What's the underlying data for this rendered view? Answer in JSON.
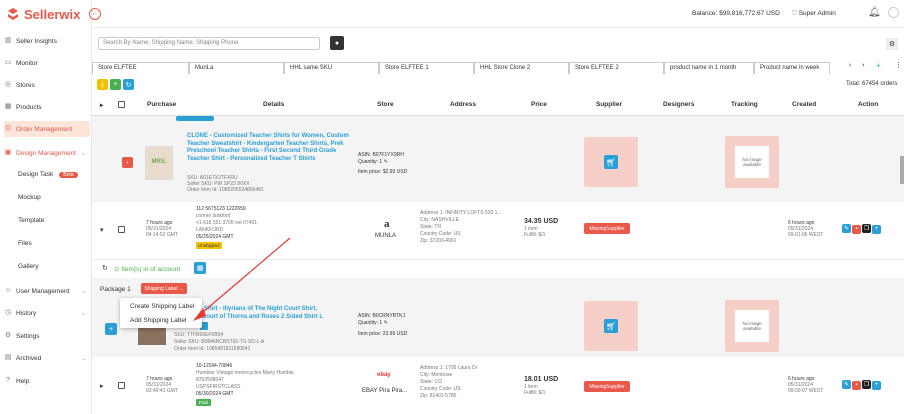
{
  "app": {
    "name": "Sellerwix"
  },
  "colors": {
    "brand": "#e8594a",
    "accent": "#2a9fd6",
    "green": "#4caf50",
    "dark": "#333333",
    "yellow": "#f2c200"
  },
  "header": {
    "balance": "Balance: $99,816,772.67 USD",
    "role": "Super Admin"
  },
  "sidebar": {
    "items": [
      {
        "label": "Seller Insights",
        "icon": "chart-icon"
      },
      {
        "label": "Monitor",
        "icon": "monitor-icon"
      },
      {
        "label": "Stores",
        "icon": "store-icon"
      },
      {
        "label": "Products",
        "icon": "grid-icon"
      },
      {
        "label": "Order Management",
        "icon": "cart-icon"
      },
      {
        "label": "Design Management",
        "icon": "palette-icon"
      },
      {
        "label": "User Management",
        "icon": "users-icon"
      },
      {
        "label": "History",
        "icon": "history-icon"
      },
      {
        "label": "Settings",
        "icon": "gear-icon"
      },
      {
        "label": "Archived",
        "icon": "archive-icon"
      },
      {
        "label": "Help",
        "icon": "help-icon"
      }
    ],
    "sub_items": [
      "Design Task",
      "Mockup",
      "Template",
      "Files",
      "Gallery"
    ],
    "beta": "Beta"
  },
  "search": {
    "placeholder": "Search By Name, Shipping Name, Shipping Phone"
  },
  "tabs": [
    "Store ELFTEE",
    "MunLa",
    "HHL same SKU",
    "Store ELFTEE 1",
    "HHL Store Clone 2",
    "Store ELFTEE 2",
    "product name in 1 month",
    "Product name in week"
  ],
  "total": "Total: 67454 orders",
  "columns": [
    "Purchase",
    "Details",
    "Store",
    "Address",
    "Price",
    "Supplier",
    "Designers",
    "Tracking",
    "Created",
    "Action"
  ],
  "row1": {
    "title": "CLONE - Customized Teacher Shirts for Women, Custom Teacher Sweatshirt - Kindergarten Teacher Shirts, Prek Preschool Teacher Shirts - First Second Third Grade Teacher Shirt - Personalized Teacher T Shirts",
    "sku": "SKU: A01E7X2TFXRU",
    "seller_sku": "Seller SKU: PW SP22 80XX",
    "order_item": "Order Item Id: 1085295534866481",
    "asin": "ASIN: B07F1YX9RH",
    "qty": "Quantity: 1",
    "item_price": "Item price: $2.99 USD",
    "no_image": "No image available",
    "thumb": "MRS."
  },
  "row2": {
    "time": "7 hours ago",
    "date": "05/31/2024",
    "time2": "04:14:52 GMT",
    "info": [
      "112 5675123 1222659",
      "conner lankford",
      "+1 618 551 3705 ext 07401",
      "LANKFORD",
      "05/25/2024 GMT"
    ],
    "status": "Unshipped",
    "store": "MUNLA",
    "addr": [
      "Address 1: INFINITY LOFTS 520 1...",
      "City: NASHVILLE",
      "State: TN",
      "Country Code: US",
      "Zip: 37203-4061"
    ],
    "price": "34.35 USD",
    "qty": "1 item",
    "fulfil": "Fulfill: $/1",
    "supplier": "MissingSupplier",
    "created": "6 hours ago",
    "created_date": "05/31/2024",
    "created_time": "09:01:06 WEST"
  },
  "toolbar2": {
    "label": "Item(s) in of account"
  },
  "package": {
    "label": "Package 1",
    "button": "Shipping Label",
    "menu": [
      "Create Shipping Label",
      "Add Shipping Label"
    ]
  },
  "row3": {
    "title_line1": "Shirt - Illyrians of The Night Court Shirt,",
    "title_line2": "Court of Thorns and Roses 2 Sided Shirt L",
    "sku": "SKU: TTFB66EF6B94",
    "seller_sku": "Seller SKU: B0846RCBST92-TS-SD-L-A",
    "order_item": "Order Item Id: 1085481811580541",
    "asin": "ASIN: B0CRNYBTKJ",
    "qty": "Quantity: 1",
    "item_price": "Item price: 23.99 USD",
    "no_image": "No image available"
  },
  "row4": {
    "info": [
      "10-11594-70846",
      "Humbler Vintage motorcycles Marty Humble",
      "8702508047",
      "USPSFIRSTCLASS",
      "05/30/2024 GMT"
    ],
    "status": "Paid",
    "time": "7 hours ago",
    "date": "05/31/2024",
    "time2": "03:49:41 GMT",
    "store": "EBAY Pira Pira...",
    "store_logo": "ebay",
    "addr": [
      "Address 1: 1795 Laura Dr",
      "City: Montrose",
      "State: CO",
      "Country Code: US",
      "Zip: 81401-5786"
    ],
    "price": "18.01 USD",
    "qty": "1 item",
    "fulfil": "Fulfill: $/1",
    "supplier": "MissingSupplier",
    "created": "6 hours ago",
    "created_date": "05/31/2024",
    "created_time": "09:00:07 WEST"
  }
}
